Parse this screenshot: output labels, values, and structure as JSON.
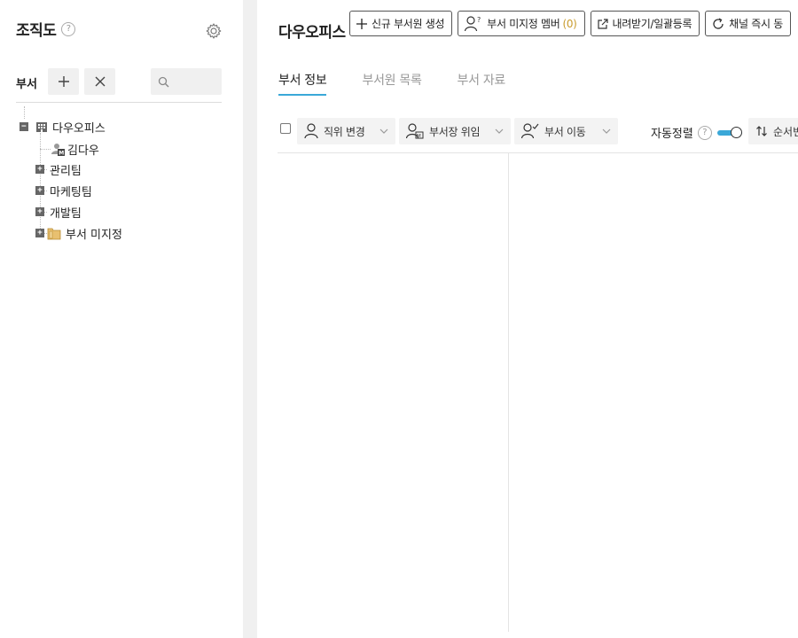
{
  "sidebar": {
    "title": "조직도",
    "help": "?",
    "toolbar_label": "부서",
    "search_placeholder": "",
    "tree": {
      "root": {
        "label": "다우오피스",
        "expander": "−"
      },
      "member": {
        "label": "김다우"
      },
      "children": [
        {
          "label": "관리팀",
          "expander": "+"
        },
        {
          "label": "마케팅팀",
          "expander": "+"
        },
        {
          "label": "개발팀",
          "expander": "+"
        },
        {
          "label": "부서 미지정",
          "expander": "+"
        }
      ]
    }
  },
  "main": {
    "title": "다우오피스",
    "buttons": {
      "create_member": "신규 부서원 생성",
      "unassigned_members": "부서 미지정 멤버",
      "unassigned_count": "(0)",
      "download_register": "내려받기/일괄등록",
      "channel_sync": "채널 즉시 동"
    },
    "tabs": [
      "부서 정보",
      "부서원 목록",
      "부서 자료"
    ],
    "toolbar": {
      "change_position": "직위 변경",
      "delegate_head": "부서장 위임",
      "move_dept": "부서 이동",
      "auto_sort": "자동정렬",
      "auto_sort_help": "?",
      "sort_order": "순서변"
    }
  },
  "colors": {
    "accent": "#3aa8d8",
    "count_highlight": "#c89b2c",
    "gutter": "#f0f0f0"
  },
  "icons": [
    "help-icon",
    "gear-icon",
    "plus-icon",
    "close-icon",
    "search-icon",
    "building-icon",
    "user-manager-icon",
    "folder-icon",
    "user-question-icon",
    "external-link-icon",
    "refresh-icon",
    "user-icon",
    "user-badge-icon",
    "user-check-icon",
    "chevron-down-icon",
    "sort-icon"
  ]
}
